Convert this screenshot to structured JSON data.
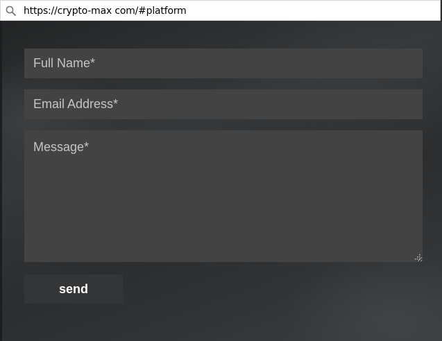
{
  "browser": {
    "url": "https://crypto-max com/#platform",
    "search_icon": "search-icon"
  },
  "form": {
    "full_name": {
      "placeholder": "Full Name*",
      "value": ""
    },
    "email": {
      "placeholder": "Email Address*",
      "value": ""
    },
    "message": {
      "placeholder": "Message*",
      "value": ""
    },
    "send_label": "send"
  },
  "colors": {
    "field_bg": "#434343",
    "button_bg": "#343536",
    "page_bg": "#2a2c2d"
  }
}
